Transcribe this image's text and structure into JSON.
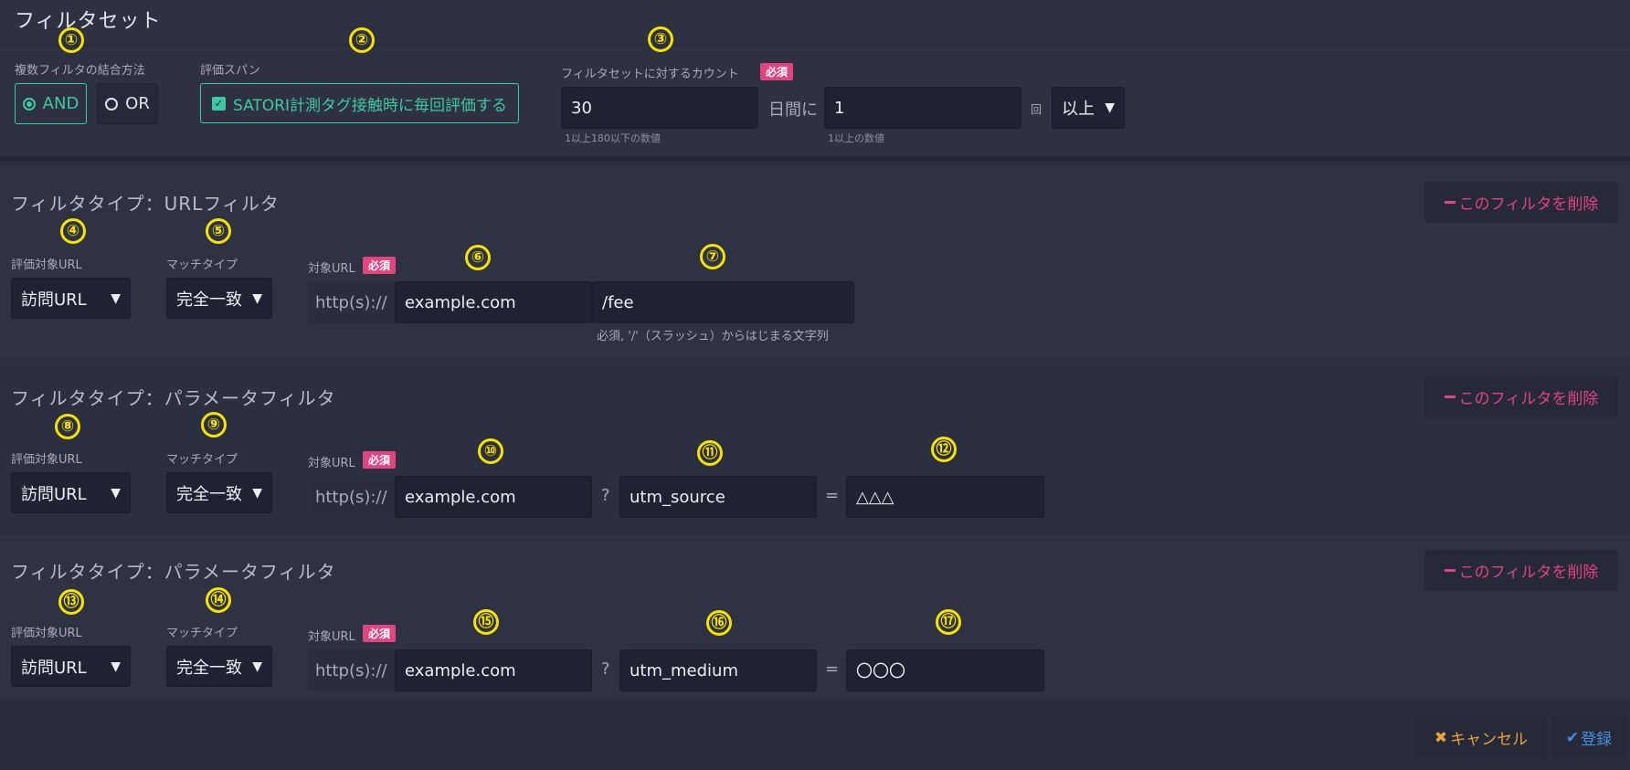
{
  "page_title": "フィルタセット",
  "markers": [
    "①",
    "②",
    "③",
    "④",
    "⑤",
    "⑥",
    "⑦",
    "⑧",
    "⑨",
    "⑩",
    "⑪",
    "⑫",
    "⑬",
    "⑭",
    "⑮",
    "⑯",
    "⑰"
  ],
  "combine": {
    "label": "複数フィルタの結合方法",
    "options": [
      "AND",
      "OR"
    ],
    "selected": "AND"
  },
  "span": {
    "label": "評価スパン",
    "checkbox_label": "SATORI計測タグ接触時に毎回評価する",
    "checked": true
  },
  "count": {
    "label": "フィルタセットに対するカウント",
    "required": "必須",
    "days_value": "30",
    "days_unit": "日間に",
    "days_hint": "1以上180以下の数値",
    "times_value": "1",
    "times_unit": "回",
    "times_hint": "1以上の数値",
    "comparator": "以上"
  },
  "filters": [
    {
      "title": "フィルタタイプ：URLフィルタ",
      "delete_label": "このフィルタを削除",
      "target_label": "評価対象URL",
      "target_value": "訪問URL",
      "match_label": "マッチタイプ",
      "match_value": "完全一致",
      "url_label": "対象URL",
      "required": "必須",
      "prefix": "http(s)://",
      "domain": "example.com",
      "path": "/fee",
      "path_hint": "必須, '/'（スラッシュ）からはじまる文字列"
    },
    {
      "title": "フィルタタイプ：パラメータフィルタ",
      "delete_label": "このフィルタを削除",
      "target_label": "評価対象URL",
      "target_value": "訪問URL",
      "match_label": "マッチタイプ",
      "match_value": "完全一致",
      "url_label": "対象URL",
      "required": "必須",
      "prefix": "http(s)://",
      "domain": "example.com",
      "q": "?",
      "param": "utm_source",
      "eq": "=",
      "value": "△△△"
    },
    {
      "title": "フィルタタイプ：パラメータフィルタ",
      "delete_label": "このフィルタを削除",
      "target_label": "評価対象URL",
      "target_value": "訪問URL",
      "match_label": "マッチタイプ",
      "match_value": "完全一致",
      "url_label": "対象URL",
      "required": "必須",
      "prefix": "http(s)://",
      "domain": "example.com",
      "q": "?",
      "param": "utm_medium",
      "eq": "=",
      "value": "〇〇〇"
    }
  ],
  "footer": {
    "cancel_label": "キャンセル",
    "submit_label": "登録"
  },
  "icons": {
    "cancel": "x-icon",
    "submit": "check-icon",
    "delete": "minus-icon",
    "dropdown": "triangle-down-icon"
  },
  "colors": {
    "accent": "#3fc9a3",
    "required": "#e0457f",
    "marker": "#f5e400",
    "cancel": "#e8a23a",
    "submit": "#4a8fe0"
  }
}
